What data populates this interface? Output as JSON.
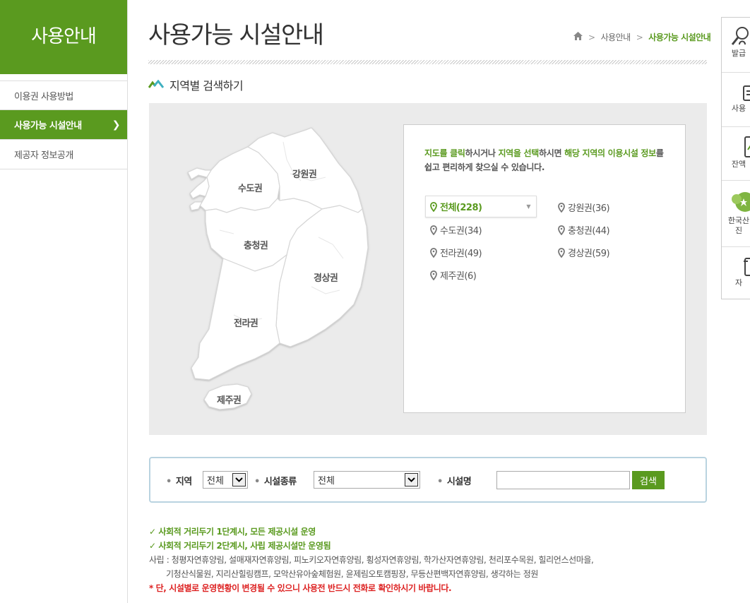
{
  "sidebar": {
    "title": "사용안내",
    "items": [
      {
        "label": "이용권 사용방법"
      },
      {
        "label": "사용가능 시설안내"
      },
      {
        "label": "제공자 정보공개"
      }
    ]
  },
  "header": {
    "title": "사용가능 시설안내",
    "breadcrumb": [
      "사용안내",
      "사용가능 시설안내"
    ]
  },
  "section": {
    "title": "지역별 검색하기"
  },
  "map": {
    "labels": {
      "sudo": "수도권",
      "gangwon": "강원권",
      "chungcheong": "충청권",
      "gyeongsang": "경상권",
      "jeolla": "전라권",
      "jeju": "제주권"
    }
  },
  "info": {
    "t1": "지도를 클릭",
    "t2": "하시거나 ",
    "t3": "지역을 선택",
    "t4": "하시면 ",
    "t5": "해당 지역의 이용시설 정보",
    "t6": "를 쉽고 편리하게 찾으실 수 있습니다.",
    "regions": [
      {
        "label": "전체(228)"
      },
      {
        "label": "강원권(36)"
      },
      {
        "label": "수도권(34)"
      },
      {
        "label": "충청권(44)"
      },
      {
        "label": "전라권(49)"
      },
      {
        "label": "경상권(59)"
      },
      {
        "label": "제주권(6)"
      }
    ]
  },
  "search": {
    "region_label": "지역",
    "region_value": "전체",
    "type_label": "시설종류",
    "type_value": "전체",
    "name_label": "시설명",
    "name_value": "",
    "button": "검색"
  },
  "notices": {
    "n1": "✓ 사회적 거리두기 1단계시, 모든 제공시설 운영",
    "n2": "✓ 사회적 거리두기 2단계시, 사립 제공시설만 운영됨",
    "n3": "사립 : 청평자연휴양림, 설매재자연휴양림, 피노키오자연휴양림, 횡성자연휴양림, 학가산자연휴양림, 천리포수목원, 힐리언스선마을,",
    "n4": "기청산식물원, 지리산힐링캠프, 모악산유아숲체험원, 윤제림오토캠핑장, 무등산편백자연휴양림, 생각하는 정원",
    "n5": "* 단, 시설별로 운영현황이 변경될 수 있으니 사용전 반드시 전화로 확인하시기 바랍니다."
  },
  "quick": [
    {
      "label": "발급",
      "icon": "search-person-icon"
    },
    {
      "label": "사용",
      "icon": "card-icon"
    },
    {
      "label": "잔액",
      "icon": "phone-icon"
    },
    {
      "label": "한국산",
      "label2": "진",
      "icon": "forest-logo-icon"
    },
    {
      "label": "자",
      "icon": "document-icon"
    }
  ],
  "colors": {
    "accent": "#5a9a1f",
    "panel": "#ebebeb",
    "warning": "#dd2222"
  }
}
